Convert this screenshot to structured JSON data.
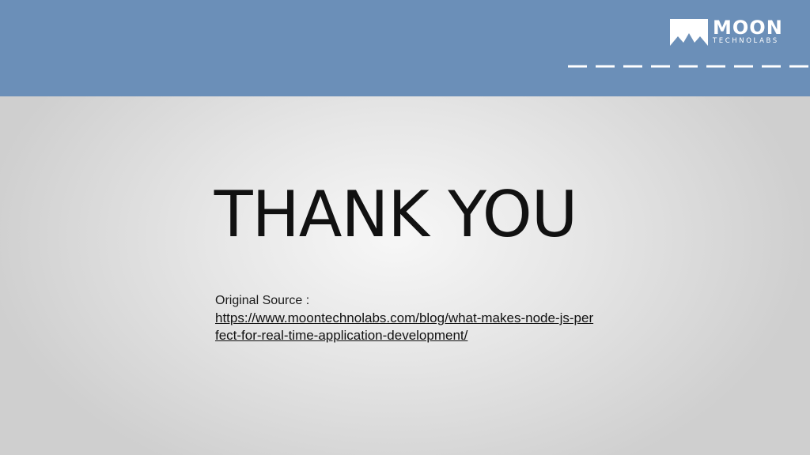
{
  "header": {
    "brand_name": "MOON",
    "brand_sub": "TECHNOLABS",
    "logo_icon": "mountain-logo-icon",
    "band_color": "#6b8fb8"
  },
  "slide": {
    "title": "THANK YOU",
    "source_label": "Original Source :",
    "source_url": "https://www.moontechnolabs.com/blog/what-makes-node-js-perfect-for-real-time-application-development/"
  }
}
